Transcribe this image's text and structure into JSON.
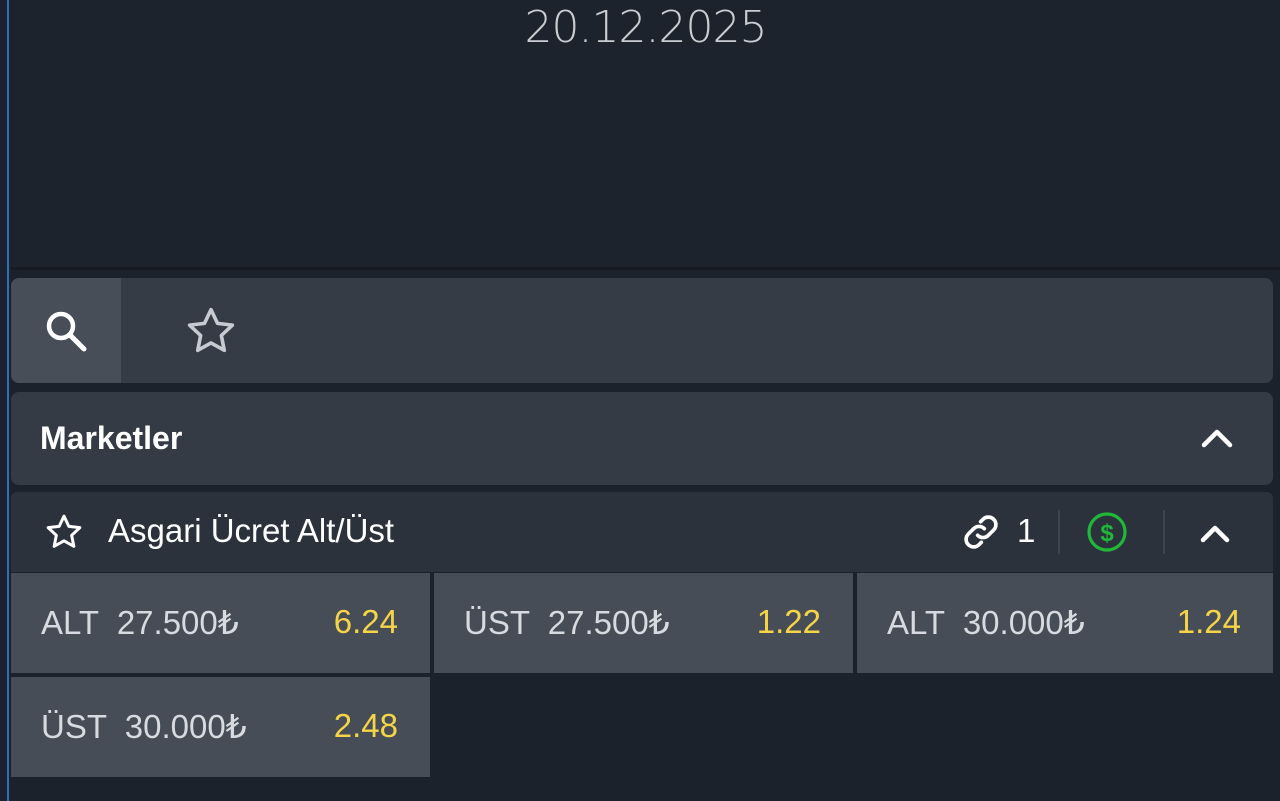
{
  "header": {
    "date": "20.12.2025"
  },
  "toolbar": {
    "search_icon": "search-icon",
    "favorites_icon": "star-outline-icon"
  },
  "section": {
    "title": "Marketler",
    "toggle_icon": "chevron-up-icon"
  },
  "market": {
    "title": "Asgari Ücret Alt/Üst",
    "star_icon": "star-outline-icon",
    "link_icon": "link-icon",
    "link_count": "1",
    "cash_icon": "dollar-circle-icon",
    "toggle_icon": "chevron-up-icon",
    "accent_color": "#f5d547",
    "cash_color": "#1fb838",
    "odds": [
      {
        "label": "ALT  27.500₺",
        "value": "6.24"
      },
      {
        "label": "ÜST  27.500₺",
        "value": "1.22"
      },
      {
        "label": "ALT  30.000₺",
        "value": "1.24"
      },
      {
        "label": "ÜST  30.000₺",
        "value": "2.48"
      }
    ]
  }
}
